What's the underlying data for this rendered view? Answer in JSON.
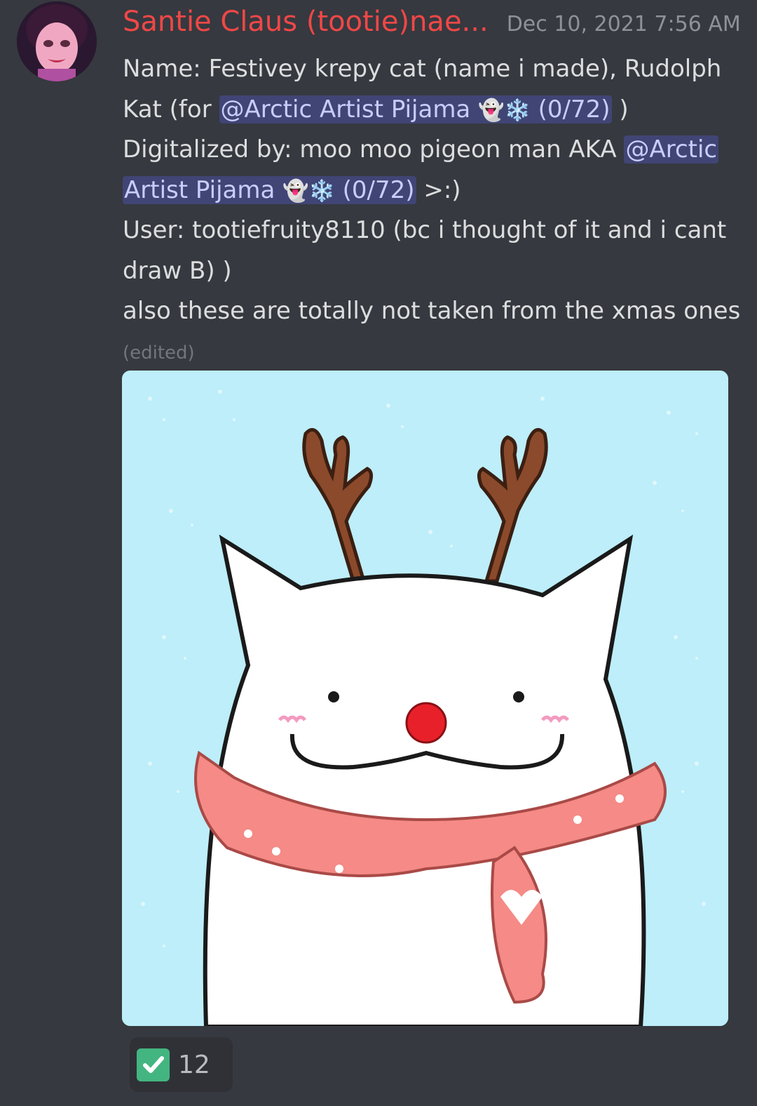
{
  "message": {
    "username": "Santie Claus (tootie)nae...",
    "timestamp": "Dec 10, 2021 7:56 AM",
    "lines": {
      "l1": "Name: Festivey krepy cat (name i made), Rudolph",
      "l2_pre": "Kat (for ",
      "l2_post": " )",
      "l3_pre": "Digitalized by: moo moo pigeon man AKA ",
      "l4_post": " >:)",
      "l5": "User: tootiefruity8110 (bc i thought of it and i cant",
      "l6": "draw B) )",
      "l7": "also these are totally not taken from the xmas ones"
    },
    "mention": {
      "full": "@Arctic Artist Pijama",
      "part1": "@Arctic",
      "part2": "Artist Pijama",
      "emoji": "👻❄️",
      "count": "(0/72)"
    },
    "edited": "(edited)"
  },
  "attachment": {
    "icon": "reindeer-cat-image"
  },
  "reaction": {
    "emoji": "white-check-mark-icon",
    "count": "12",
    "color": "#43b581"
  },
  "colors": {
    "background": "#36393f",
    "username": "#f04747",
    "mention_text": "#c9cdfb",
    "image_bg": "#bdeefa"
  }
}
